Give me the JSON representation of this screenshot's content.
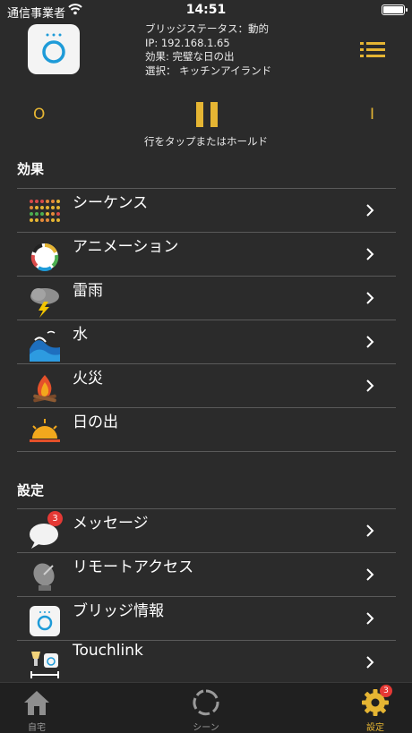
{
  "status_bar": {
    "carrier": "通信事業者",
    "time": "14:51"
  },
  "bridge": {
    "status": "ブリッジステータス：動的",
    "ip": "IP: 192.168.1.65",
    "effect": "効果: 完璧な日の出",
    "selection": "選択： キッチンアイランド"
  },
  "controls": {
    "off_label": "O",
    "on_label": "I",
    "hint": "行をタップまたはホールド"
  },
  "effects": {
    "title": "効果",
    "items": [
      {
        "label": "シーケンス",
        "icon": "sequence-dots-icon"
      },
      {
        "label": "アニメーション",
        "icon": "animation-ring-icon"
      },
      {
        "label": "雷雨",
        "icon": "thunderstorm-icon"
      },
      {
        "label": "水",
        "icon": "water-wave-icon"
      },
      {
        "label": "火災",
        "icon": "campfire-icon"
      },
      {
        "label": "日の出",
        "icon": "sunrise-icon"
      }
    ]
  },
  "settings": {
    "title": "設定",
    "items": [
      {
        "label": "メッセージ",
        "icon": "message-bubble-icon",
        "badge": "3"
      },
      {
        "label": "リモートアクセス",
        "icon": "satellite-dish-icon"
      },
      {
        "label": "ブリッジ情報",
        "icon": "bridge-icon"
      },
      {
        "label": "Touchlink",
        "icon": "touchlink-icon"
      }
    ]
  },
  "tabs": [
    {
      "label": "自宅",
      "icon": "home-icon"
    },
    {
      "label": "シーン",
      "icon": "scene-ring-icon"
    },
    {
      "label": "設定",
      "icon": "gear-icon",
      "badge": "3",
      "active": true
    }
  ],
  "colors": {
    "accent": "#e5b533",
    "background": "#2b2b2b",
    "badge": "#e53935"
  }
}
